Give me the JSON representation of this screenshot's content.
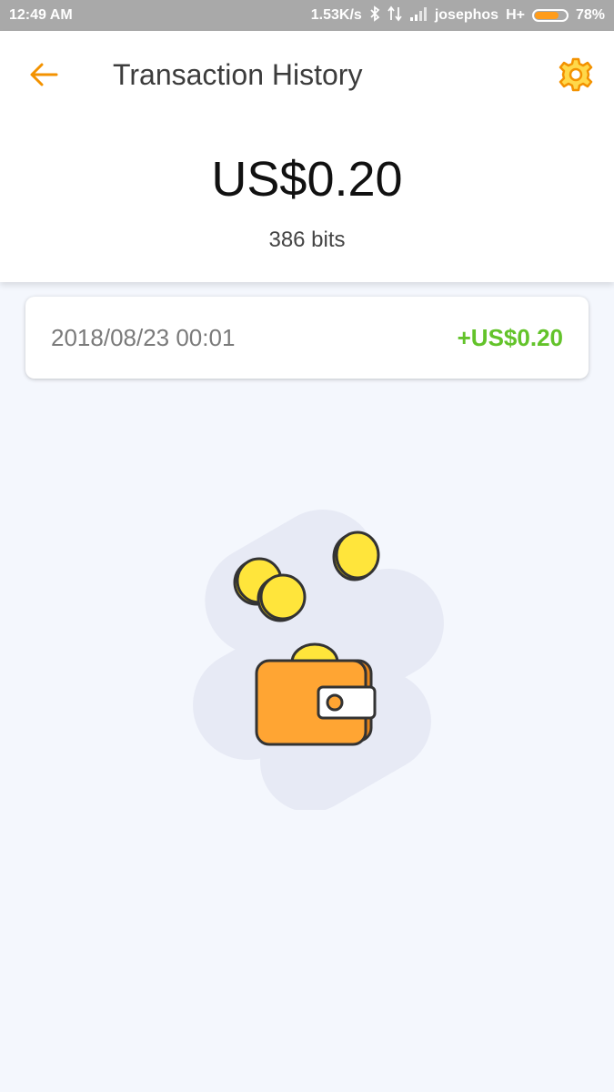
{
  "status_bar": {
    "time": "12:49 AM",
    "network_speed": "1.53K/s",
    "carrier": "josephos",
    "network_type": "H+",
    "battery_percent": "78%",
    "battery_level": 0.78,
    "icons": [
      "bluetooth-icon",
      "data-transfer-icon",
      "signal-icon",
      "battery-icon"
    ]
  },
  "header": {
    "title": "Transaction History",
    "back_icon": "arrow-left-icon",
    "settings_icon": "gear-icon",
    "accent_color": "#f39200"
  },
  "summary": {
    "balance": "US$0.20",
    "bits": "386 bits"
  },
  "transactions": [
    {
      "date": "2018/08/23 00:01",
      "amount": "+US$0.20",
      "amount_color": "#63c32a"
    }
  ],
  "illustration": {
    "icon": "wallet-with-coins-icon"
  }
}
